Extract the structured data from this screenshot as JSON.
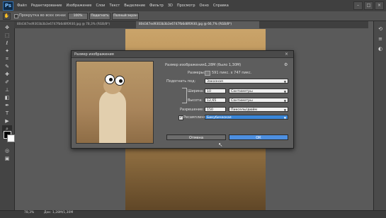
{
  "app": {
    "logo": "Ps"
  },
  "menu": [
    "Файл",
    "Редактирование",
    "Изображение",
    "Слои",
    "Текст",
    "Выделение",
    "Фильтр",
    "3D",
    "Просмотр",
    "Окно",
    "Справка"
  ],
  "options": {
    "checkbox1_label": "Прокрутка во всех окнах",
    "zoom_value": "100%",
    "fit_button": "Подогнать",
    "fill_button": "Полный экран"
  },
  "tabs": [
    {
      "label": "80d347ed9303b3b3e6747fb6d8f0930.jpg @ 78,3% (RGB/8*)"
    },
    {
      "label": "80d347ed9303b3b3e6747fb6d8f0930.jpg @ 66,7% (RGB/8*)"
    }
  ],
  "status": {
    "zoom": "78,3%",
    "doc": "Док: 1,28M/1,30M"
  },
  "dialog": {
    "title": "Размер изображения",
    "image_size_label": "Размер изображения:",
    "image_size_value": "1,28M (было 1,30M)",
    "dimensions_label": "Размеры:",
    "dimensions_value": "591 пикс. x 747 пикс.",
    "fit_to_label": "Подогнать под:",
    "fit_to_value": "Заказная",
    "width_label": "Ширина:",
    "width_value": "10",
    "width_unit": "Сантиметры",
    "height_label": "Высота:",
    "height_value": "12,65",
    "height_unit": "Сантиметры",
    "resolution_label": "Разрешение:",
    "resolution_value": "150",
    "resolution_unit": "Пикселы/дюйм",
    "resample_label": "Ресамплинг:",
    "resample_value": "Бикубическая",
    "cancel_button": "Отмена",
    "ok_button": "ОК"
  },
  "colors": {
    "accent": "#4d8fe0",
    "menubar": "#404040",
    "dialog_bg": "#5d5d5d"
  }
}
